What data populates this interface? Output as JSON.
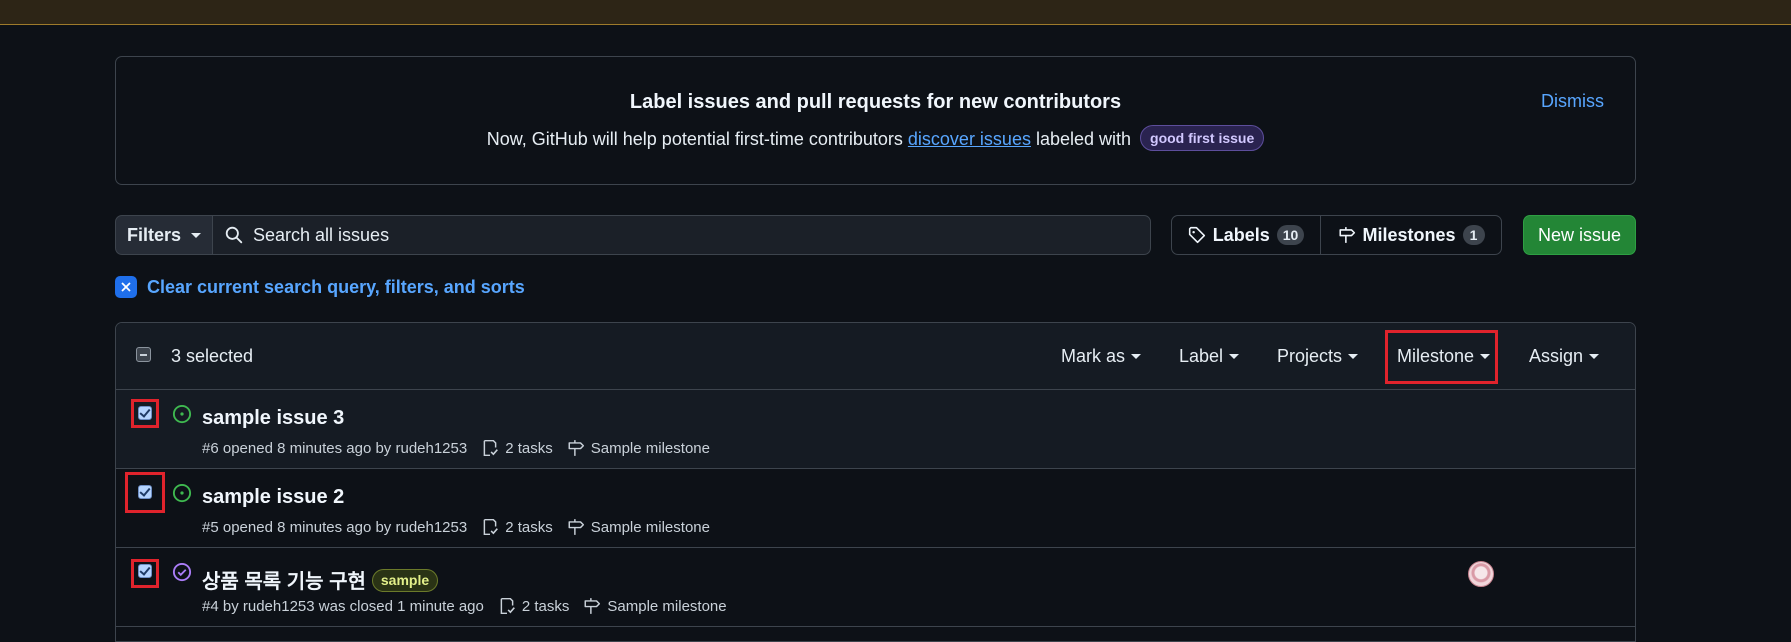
{
  "banner": {
    "title": "Label issues and pull requests for new contributors",
    "text_before": "Now, GitHub will help potential first-time contributors ",
    "link": "discover issues",
    "text_after": " labeled with ",
    "label": "good first issue",
    "dismiss": "Dismiss"
  },
  "toolbar": {
    "filters_label": "Filters",
    "search_placeholder": "Search all issues",
    "labels_label": "Labels",
    "labels_count": "10",
    "milestones_label": "Milestones",
    "milestones_count": "1",
    "new_issue_label": "New issue"
  },
  "clear_filters": "Clear current search query, filters, and sorts",
  "list_header": {
    "selected": "3 selected",
    "menus": [
      "Mark as",
      "Label",
      "Projects",
      "Milestone",
      "Assign"
    ]
  },
  "issues": [
    {
      "title": "sample issue 3",
      "meta": "#6 opened 8 minutes ago by rudeh1253",
      "tasks": "2 tasks",
      "milestone": "Sample milestone",
      "state": "open",
      "label": ""
    },
    {
      "title": "sample issue 2",
      "meta": "#5 opened 8 minutes ago by rudeh1253",
      "tasks": "2 tasks",
      "milestone": "Sample milestone",
      "state": "open",
      "label": ""
    },
    {
      "title": "상품 목록 기능 구현",
      "meta": "#4 by rudeh1253 was closed 1 minute ago",
      "tasks": "2 tasks",
      "milestone": "Sample milestone",
      "state": "closed",
      "label": "sample"
    }
  ],
  "colors": {
    "background": "#0d1117",
    "accent_link": "#58a6ff",
    "open_icon": "#3fb950",
    "closed_icon": "#ab7df8",
    "new_issue": "#238636",
    "highlight": "#e0232c"
  }
}
